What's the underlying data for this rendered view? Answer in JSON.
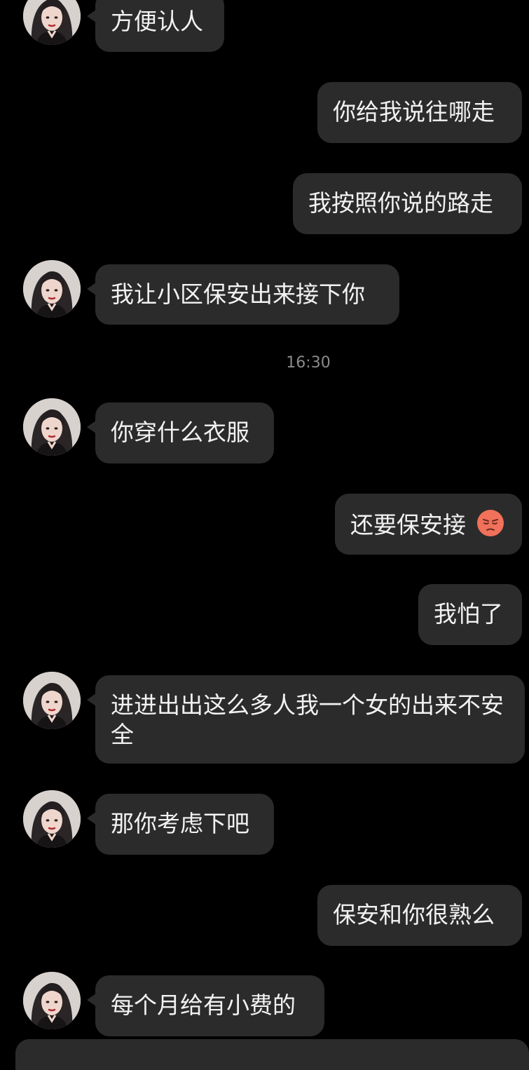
{
  "colors": {
    "background": "#000000",
    "bubble": "#2b2b2b",
    "text": "#f2f2f2",
    "timestamp": "#8a8a8a",
    "emoji": "#f2715a"
  },
  "messages": [
    {
      "side": "left",
      "text": "方便认人"
    },
    {
      "side": "right",
      "text": "你给我说往哪走"
    },
    {
      "side": "right",
      "text": "我按照你说的路走"
    },
    {
      "side": "left",
      "text": "我让小区保安出来接下你"
    },
    {
      "timestamp": "16:30"
    },
    {
      "side": "left",
      "text": "你穿什么衣服"
    },
    {
      "side": "right",
      "text": "还要保安接",
      "emoji": "pouting-face-icon"
    },
    {
      "side": "right",
      "text": "我怕了"
    },
    {
      "side": "left",
      "text": "进进出出这么多人我一个女的出来不安全"
    },
    {
      "side": "left",
      "text": "那你考虑下吧"
    },
    {
      "side": "right",
      "text": "保安和你很熟么"
    },
    {
      "side": "left",
      "text": "每个月给有小费的"
    }
  ]
}
